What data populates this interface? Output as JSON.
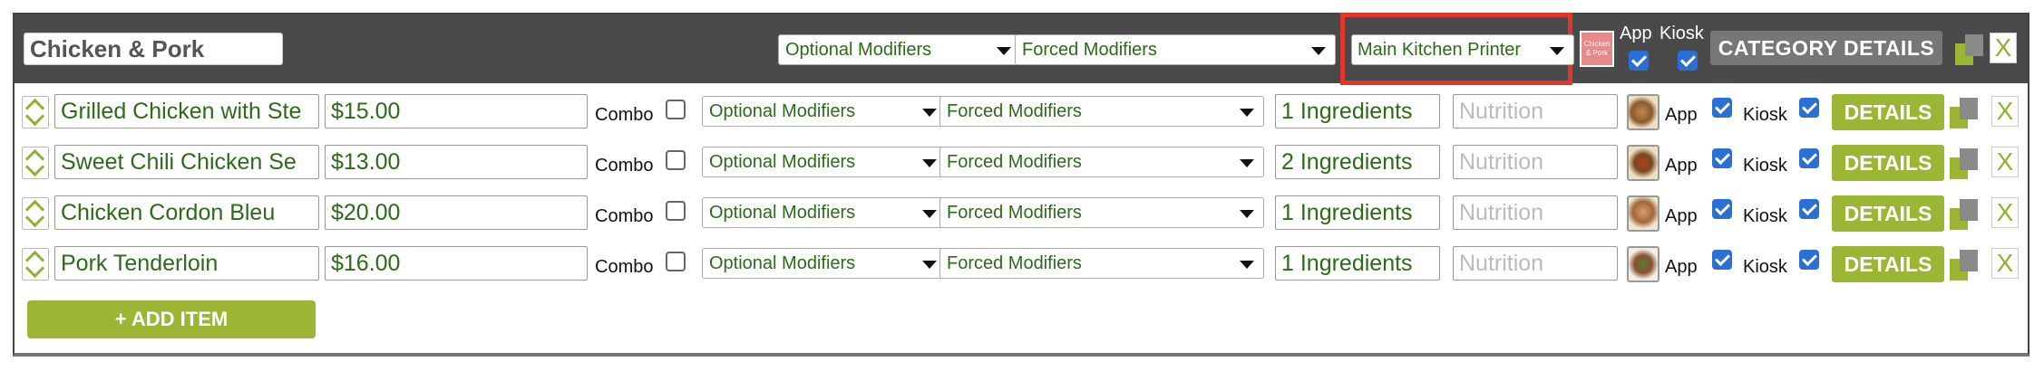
{
  "category": {
    "name": "Chicken & Pork",
    "optional_modifiers": "Optional Modifiers",
    "forced_modifiers": "Forced Modifiers",
    "printer": "Main Kitchen Printer",
    "thumb_text": "Chicken & Pork",
    "app_label": "App",
    "kiosk_label": "Kiosk",
    "app_checked": true,
    "kiosk_checked": true,
    "details_label": "CATEGORY DETAILS",
    "delete_label": "X"
  },
  "items": [
    {
      "name": "Grilled Chicken with Ste",
      "price": "$15.00",
      "combo_label": "Combo",
      "combo_checked": false,
      "optional_modifiers": "Optional Modifiers",
      "forced_modifiers": "Forced Modifiers",
      "ingredients": "1 Ingredients",
      "nutrition_placeholder": "Nutrition",
      "app_label": "App",
      "kiosk_label": "Kiosk",
      "app_checked": true,
      "kiosk_checked": true,
      "details_label": "DETAILS",
      "delete_label": "X"
    },
    {
      "name": "Sweet Chili Chicken Se",
      "price": "$13.00",
      "combo_label": "Combo",
      "combo_checked": false,
      "optional_modifiers": "Optional Modifiers",
      "forced_modifiers": "Forced Modifiers",
      "ingredients": "2 Ingredients",
      "nutrition_placeholder": "Nutrition",
      "app_label": "App",
      "kiosk_label": "Kiosk",
      "app_checked": true,
      "kiosk_checked": true,
      "details_label": "DETAILS",
      "delete_label": "X"
    },
    {
      "name": "Chicken Cordon Bleu",
      "price": "$20.00",
      "combo_label": "Combo",
      "combo_checked": false,
      "optional_modifiers": "Optional Modifiers",
      "forced_modifiers": "Forced Modifiers",
      "ingredients": "1 Ingredients",
      "nutrition_placeholder": "Nutrition",
      "app_label": "App",
      "kiosk_label": "Kiosk",
      "app_checked": true,
      "kiosk_checked": true,
      "details_label": "DETAILS",
      "delete_label": "X"
    },
    {
      "name": "Pork Tenderloin",
      "price": "$16.00",
      "combo_label": "Combo",
      "combo_checked": false,
      "optional_modifiers": "Optional Modifiers",
      "forced_modifiers": "Forced Modifiers",
      "ingredients": "1 Ingredients",
      "nutrition_placeholder": "Nutrition",
      "app_label": "App",
      "kiosk_label": "Kiosk",
      "app_checked": true,
      "kiosk_checked": true,
      "details_label": "DETAILS",
      "delete_label": "X"
    }
  ],
  "add_item_label": "+ ADD ITEM",
  "colors": {
    "header_bg": "#4a4a4a",
    "accent_green": "#9bb634",
    "text_green": "#2d6a1a",
    "highlight_red": "#e0362c",
    "checkbox_blue": "#2a6fd6"
  }
}
